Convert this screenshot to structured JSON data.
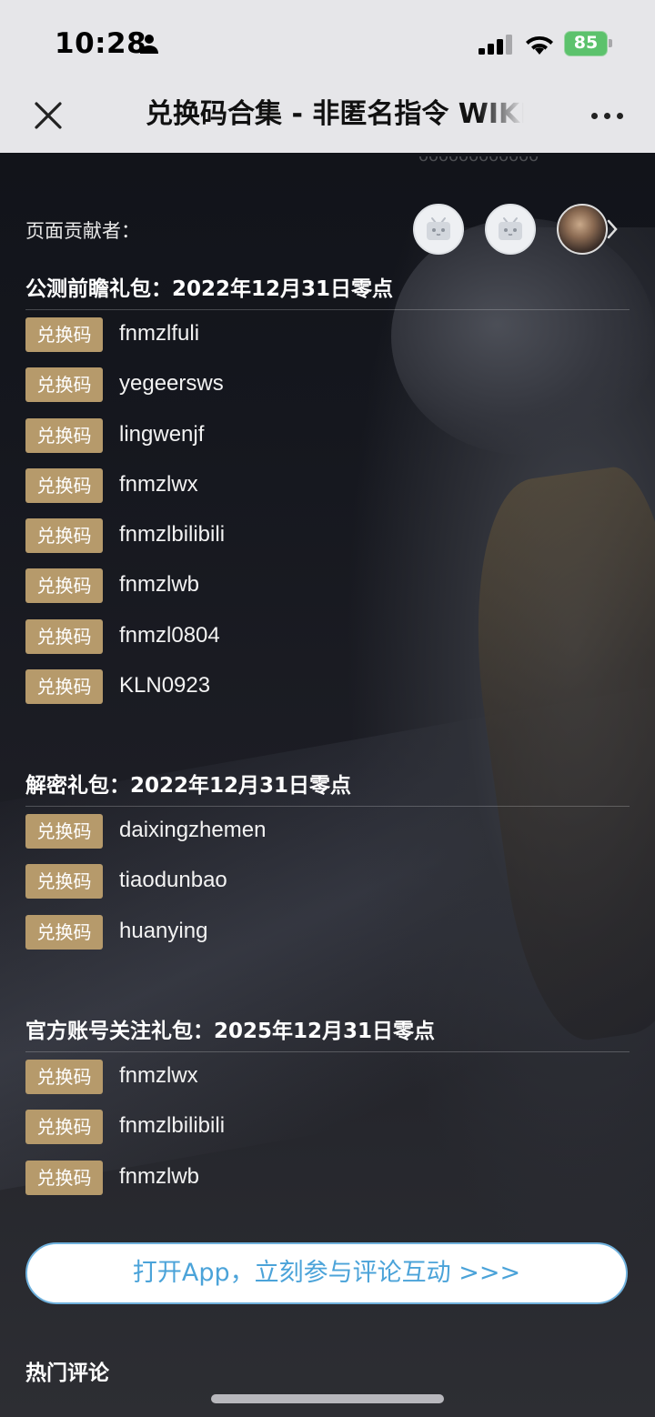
{
  "status_bar": {
    "time": "10:28",
    "battery": "85"
  },
  "header": {
    "title": "兑换码合集 - 非匿名指令 WIKI"
  },
  "contributors": {
    "label": "页面贡献者："
  },
  "badge_label": "兑换码",
  "sections": [
    {
      "title": "公测前瞻礼包：2022年12月31日零点",
      "codes": [
        "fnmzlfuli",
        "yegeersws",
        "lingwenjf",
        "fnmzlwx",
        "fnmzlbilibili",
        "fnmzlwb",
        "fnmzl0804",
        "KLN0923"
      ]
    },
    {
      "title": "解密礼包：2022年12月31日零点",
      "codes": [
        "daixingzhemen",
        "tiaodunbao",
        "huanying"
      ]
    },
    {
      "title": "官方账号关注礼包：2025年12月31日零点",
      "codes": [
        "fnmzlwx",
        "fnmzlbilibili",
        "fnmzlwb"
      ]
    }
  ],
  "open_app_button": "打开App，立刻参与评论互动 >>>",
  "hot_comments_title": "热门评论",
  "colors": {
    "badge": "#b69a6b",
    "link_blue": "#4ba3d9",
    "battery_green": "#5cc26c"
  }
}
